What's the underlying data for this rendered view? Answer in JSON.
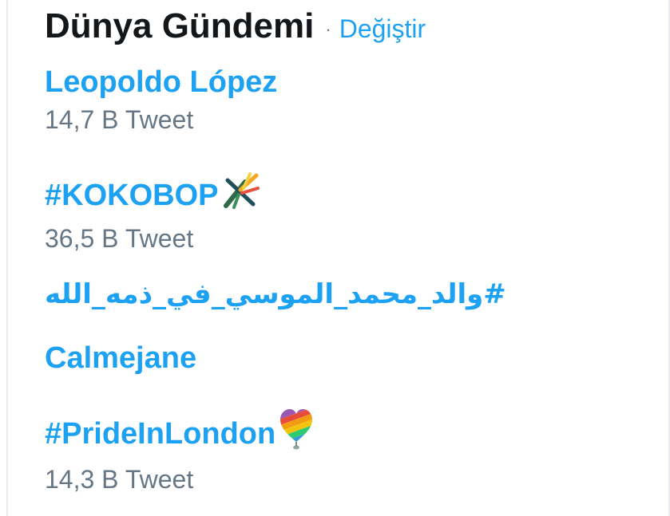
{
  "header": {
    "title": "Dünya Gündemi",
    "separator": "·",
    "change_link": "Değiştir"
  },
  "trends": [
    {
      "name": "Leopoldo López",
      "tweet_count": "14,7 B Tweet",
      "icon": ""
    },
    {
      "name": "#KOKOBOP",
      "tweet_count": "36,5 B Tweet",
      "icon": "kokobop-emoji-icon"
    },
    {
      "name": "#والد_محمد_الموسي_في_ذمه_الله",
      "tweet_count": "",
      "icon": ""
    },
    {
      "name": "Calmejane",
      "tweet_count": "",
      "icon": ""
    },
    {
      "name": "#PrideInLondon",
      "tweet_count": "14,3 B Tweet",
      "icon": "pride-heart-pin-icon"
    }
  ],
  "colors": {
    "link": "#1da1f2",
    "title": "#14171a",
    "secondary": "#657786",
    "border": "#e6ecf0"
  }
}
